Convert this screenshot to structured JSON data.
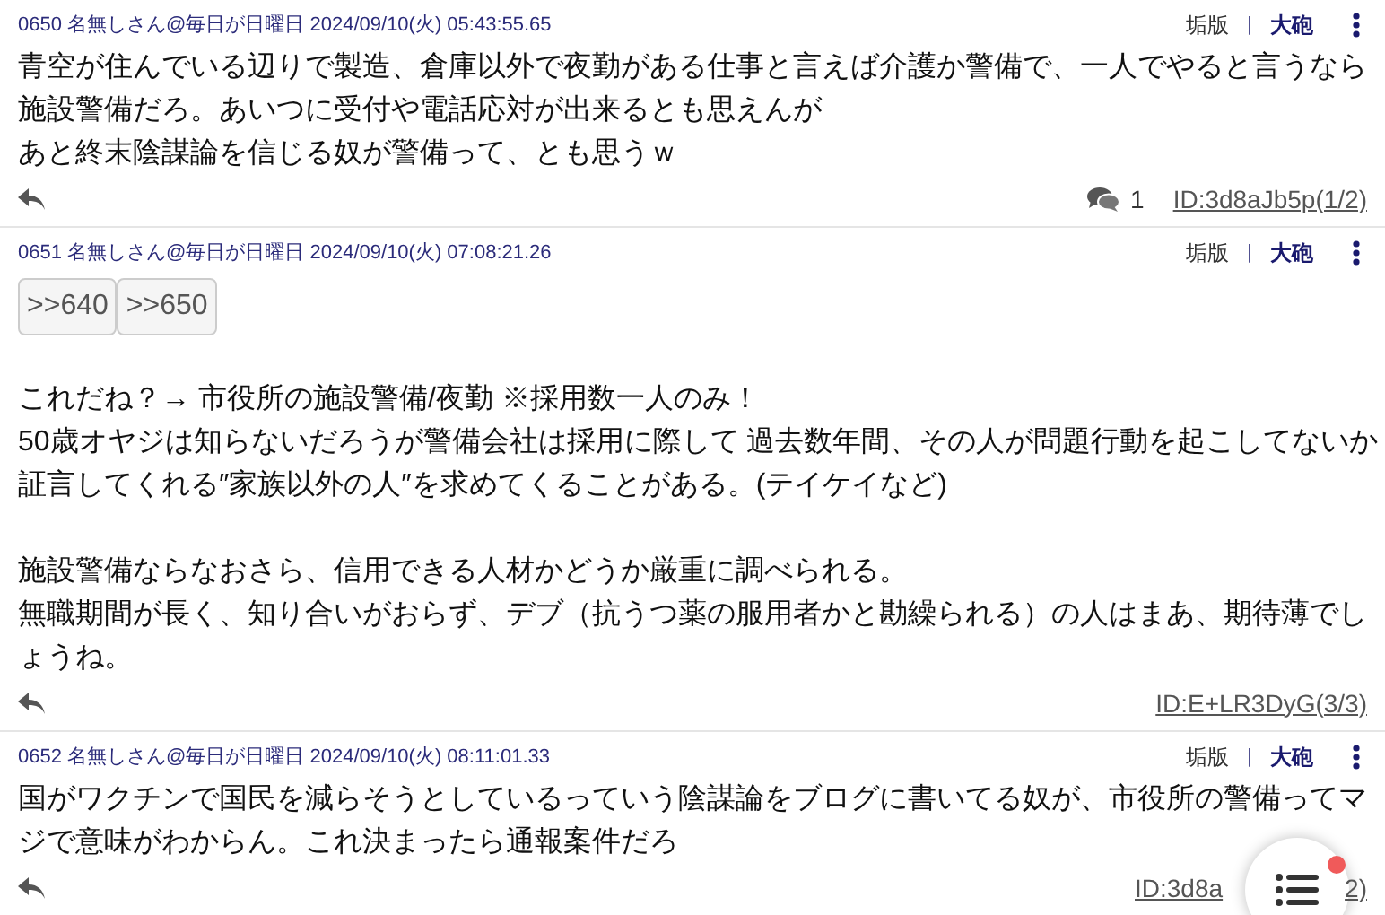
{
  "posts": [
    {
      "header": "0650 名無しさん@毎日が日曜日 2024/09/10(火) 05:43:55.65",
      "actions": [
        "垢版",
        "大砲"
      ],
      "separator": "|",
      "blocks": [
        [
          "青空が住んでいる辺りで製造、倉庫以外で夜勤がある仕事と言えば介護か警備で、一人でやると言うなら",
          "施設警備だろ。あいつに受付や電話応対が出来るとも思えんが",
          "あと終末陰謀論を信じる奴が警備って、とも思うｗ"
        ]
      ],
      "reply_count": "1",
      "id": "ID:3d8aJb5p(1/2)"
    },
    {
      "header": "0651 名無しさん@毎日が日曜日 2024/09/10(火) 07:08:21.26",
      "actions": [
        "垢版",
        "大砲"
      ],
      "separator": "|",
      "anchors": [
        ">>640",
        ">>650"
      ],
      "blocks": [
        [
          "これだね？→ 市役所の施設警備/夜勤 ※採用数一人のみ！",
          "50歳オヤジは知らないだろうが警備会社は採用に際して 過去数年間、その人が問題行動を起こしてないか",
          "証言してくれる″家族以外の人″を求めてくることがある。(テイケイなど)"
        ],
        [
          "施設警備ならなおさら、信用できる人材かどうか厳重に調べられる。",
          "無職期間が長く、知り合いがおらず、デブ（抗うつ薬の服用者かと勘繰られる）の人はまあ、期待薄でし",
          "ょうね。"
        ]
      ],
      "id": "ID:E+LR3DyG(3/3)"
    },
    {
      "header": "0652 名無しさん@毎日が日曜日 2024/09/10(火) 08:11:01.33",
      "actions": [
        "垢版",
        "大砲"
      ],
      "separator": "|",
      "blocks": [
        [
          "国がワクチンで国民を減らそうとしているっていう陰謀論をブログに書いてる奴が、市役所の警備ってマ",
          "ジで意味がわからん。これ決まったら通報案件だろ"
        ]
      ],
      "id": "ID:3d8a",
      "id_tail": "2)"
    }
  ],
  "fab": {
    "notification": true
  }
}
